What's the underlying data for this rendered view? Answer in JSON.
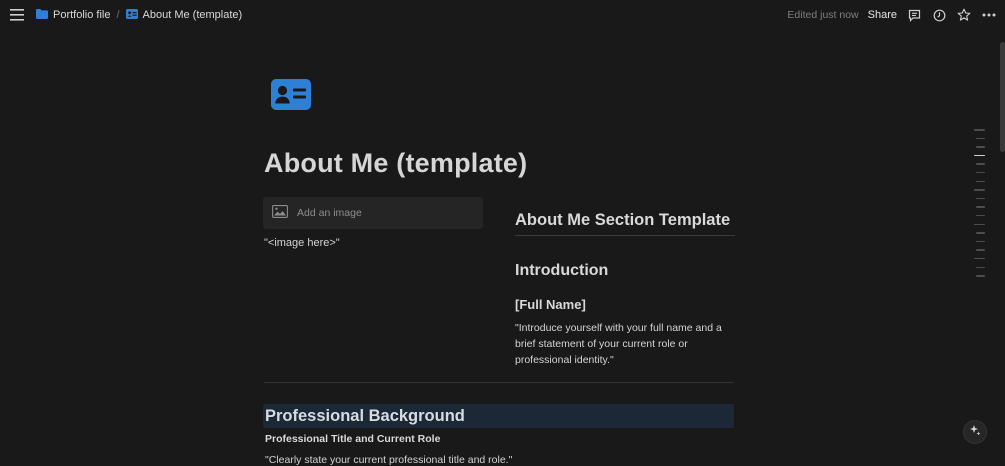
{
  "topbar": {
    "breadcrumb": [
      {
        "label": "Portfolio file",
        "icon": "folder-icon"
      },
      {
        "label": "About Me (template)",
        "icon": "contact-card-icon"
      }
    ],
    "separator": "/",
    "edited": "Edited just now",
    "share_label": "Share"
  },
  "page": {
    "icon": "contact-card-icon",
    "title": "About Me (template)"
  },
  "left_col": {
    "add_image_label": "Add an image",
    "image_caption": "\"<image here>\""
  },
  "right_col": {
    "section_heading": "About Me Section Template",
    "intro_heading": "Introduction",
    "name_heading": "[Full Name]",
    "intro_text": "\"Introduce yourself with your full name and a brief statement of your current role or professional identity.\""
  },
  "professional": {
    "heading": "Professional Background",
    "subheading": "Professional Title and Current Role",
    "text": "\"Clearly state your current professional title and role.\""
  },
  "colors": {
    "background": "#191919",
    "accent": "#2e7fd6",
    "highlight": "#1c2835"
  }
}
